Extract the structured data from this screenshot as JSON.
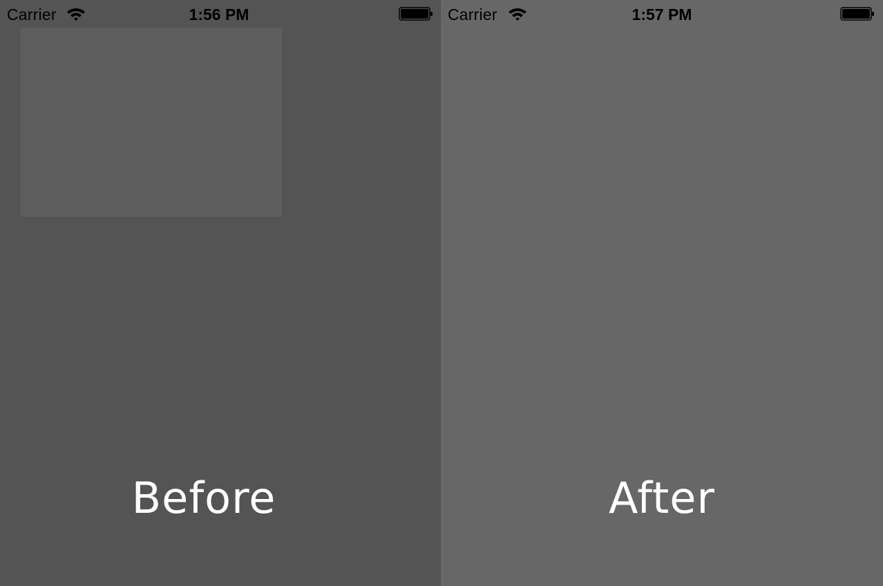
{
  "before": {
    "status": {
      "carrier": "Carrier",
      "time": "1:56 PM",
      "wifi_icon": "wifi-icon",
      "battery_icon": "battery-icon"
    },
    "caption": "Before"
  },
  "after": {
    "status": {
      "carrier": "Carrier",
      "time": "1:57 PM",
      "wifi_icon": "wifi-icon",
      "battery_icon": "battery-icon"
    },
    "caption": "After"
  },
  "colors": {
    "before_background": "#545454",
    "after_background": "#676767",
    "box_fill": "#5e5e5e",
    "caption_text": "#ffffff",
    "status_text": "#000000"
  }
}
